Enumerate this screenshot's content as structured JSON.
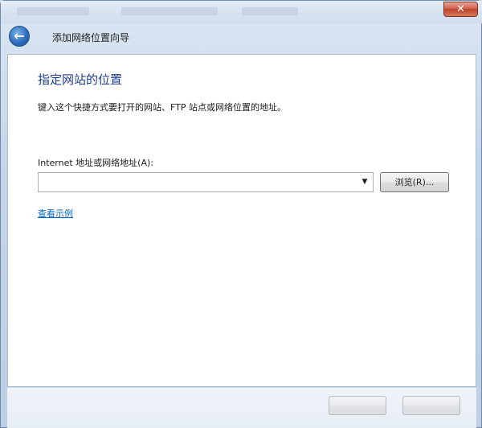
{
  "window": {
    "close_glyph": "✕"
  },
  "navbar": {
    "back_glyph": "←",
    "title": "添加网络位置向导"
  },
  "content": {
    "heading": "指定网站的位置",
    "instruction": "键入这个快捷方式要打开的网站、FTP 站点或网络位置的地址。",
    "field_label": "Internet 地址或网络地址(A):",
    "address_value": "",
    "dropdown_glyph": "▼",
    "browse_label": "浏览(R)...",
    "example_link": "查看示例"
  },
  "colors": {
    "heading": "#1e3c8f",
    "link": "#0066cc",
    "close_button": "#c0412b",
    "back_button": "#2d6fbd"
  },
  "icons": {
    "back": "back-arrow-icon",
    "close": "close-icon",
    "dropdown": "chevron-down-icon"
  }
}
